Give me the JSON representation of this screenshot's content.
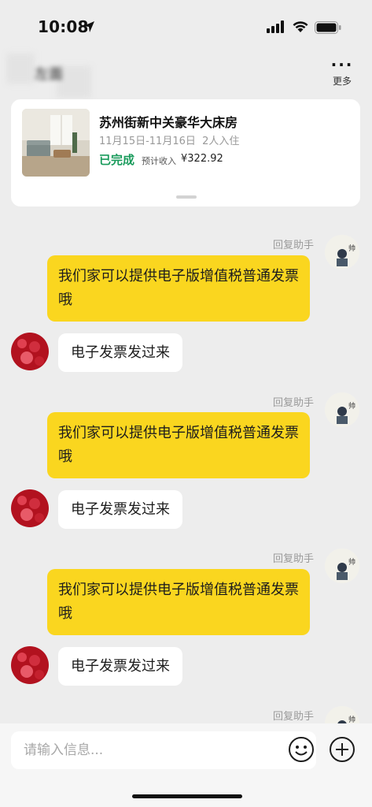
{
  "status_bar": {
    "time": "10:08"
  },
  "nav": {
    "title": "左面",
    "more_label": "更多",
    "more_icon": "ellipsis-icon"
  },
  "order_card": {
    "room_title": "苏州街新中关豪华大床房",
    "dates_guests": "11月15日-11月16日  2人入住",
    "status": "已完成",
    "income_label": "预计收入",
    "income_value": "¥322.92"
  },
  "messages": [
    {
      "type": "outgoing",
      "sender": "回复助手",
      "text": "我们家可以提供电子版增值税普通发票哦"
    },
    {
      "type": "incoming",
      "text": "电子发票发过来"
    },
    {
      "type": "outgoing",
      "sender": "回复助手",
      "text": "我们家可以提供电子版增值税普通发票哦"
    },
    {
      "type": "incoming",
      "text": "电子发票发过来"
    },
    {
      "type": "outgoing",
      "sender": "回复助手",
      "text": "我们家可以提供电子版增值税普通发票哦"
    },
    {
      "type": "incoming",
      "text": "电子发票发过来"
    },
    {
      "type": "outgoing",
      "sender": "回复助手",
      "text": ""
    }
  ],
  "input": {
    "placeholder": "请输入信息...",
    "value": ""
  },
  "colors": {
    "bubble_out": "#fad61f",
    "status_green": "#1a9b5c",
    "background": "#ededed"
  }
}
